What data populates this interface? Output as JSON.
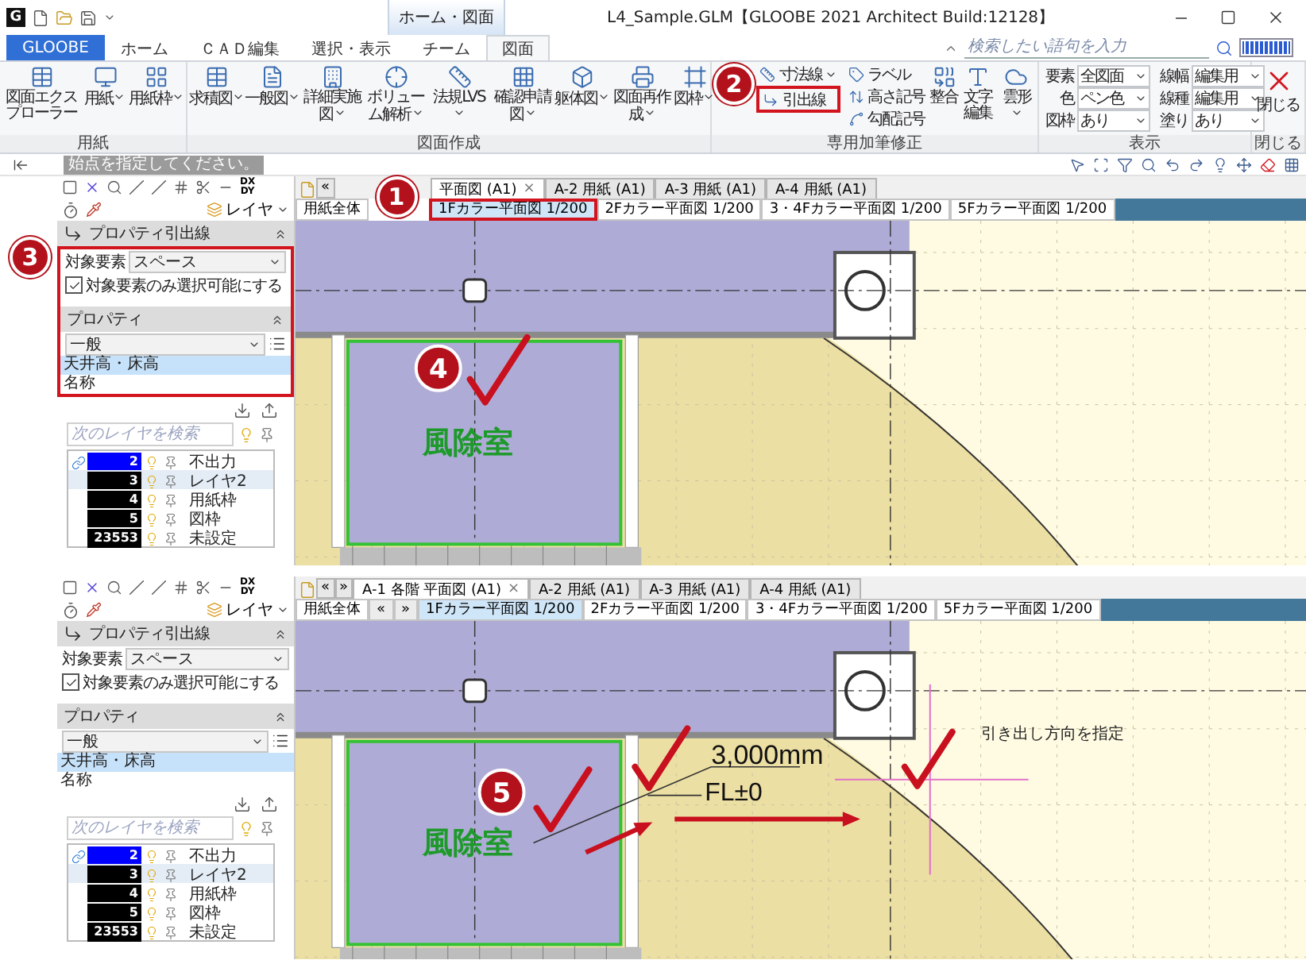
{
  "title_bar": {
    "app_logo": "G",
    "context_tab": "ホーム・図面",
    "title": "L4_Sample.GLM【GLOOBE 2021 Architect Build:12128】"
  },
  "ribbon_tabs": [
    {
      "label": "GLOOBE",
      "kind": "app",
      "selected": false
    },
    {
      "label": "ホーム",
      "kind": "tab",
      "selected": false
    },
    {
      "label": "ＣＡＤ編集",
      "kind": "tab",
      "selected": false
    },
    {
      "label": "選択・表示",
      "kind": "tab",
      "selected": false
    },
    {
      "label": "チーム",
      "kind": "tab",
      "selected": false
    },
    {
      "label": "図面",
      "kind": "tab",
      "selected": true
    }
  ],
  "search": {
    "placeholder": "検索したい語句を入力"
  },
  "ribbon_groups": [
    {
      "label": "用紙",
      "items": [
        {
          "kind": "large",
          "label": "図面エクスプローラー",
          "dropdown": false
        },
        {
          "kind": "large",
          "label": "用紙",
          "dropdown": true
        },
        {
          "kind": "large",
          "label": "用紙枠",
          "dropdown": true
        }
      ]
    },
    {
      "label": "図面作成",
      "items": [
        {
          "kind": "large",
          "label": "求積図",
          "dropdown": true
        },
        {
          "kind": "large",
          "label": "一般図",
          "dropdown": true
        },
        {
          "kind": "large",
          "label": "詳細実施図",
          "dropdown": true
        },
        {
          "kind": "large",
          "label": "ボリューム解析",
          "dropdown": true
        },
        {
          "kind": "large",
          "label": "法規LVS",
          "dropdown": true
        },
        {
          "kind": "large",
          "label": "確認申請図",
          "dropdown": true
        },
        {
          "kind": "large",
          "label": "躯体図",
          "dropdown": true
        },
        {
          "kind": "large",
          "label": "図面再作成",
          "dropdown": true
        },
        {
          "kind": "large",
          "label": "図枠",
          "dropdown": true
        }
      ]
    },
    {
      "label": "専用加筆修正",
      "badge": "2",
      "items": [
        {
          "kind": "stack",
          "buttons": [
            {
              "label": "寸法線",
              "dropdown": true,
              "highlighted": false
            },
            {
              "label": "引出線",
              "dropdown": false,
              "highlighted": true
            }
          ]
        },
        {
          "kind": "stack",
          "buttons": [
            {
              "label": "ラベル",
              "dropdown": false,
              "highlighted": false
            },
            {
              "label": "高さ記号",
              "dropdown": false,
              "highlighted": false
            },
            {
              "label": "勾配記号",
              "dropdown": false,
              "highlighted": false
            }
          ]
        },
        {
          "kind": "large",
          "label": "整合",
          "dropdown": false
        },
        {
          "kind": "large",
          "label": "文字編集",
          "dropdown": false
        },
        {
          "kind": "large",
          "label": "雲形",
          "dropdown": true
        }
      ]
    },
    {
      "label": "表示",
      "items": [
        {
          "kind": "settings",
          "fields": [
            {
              "label": "要素",
              "value": "全図面"
            },
            {
              "label": "色",
              "value": "ペン色"
            },
            {
              "label": "図枠",
              "value": "あり"
            },
            {
              "label": "線幅",
              "value": "編集用"
            },
            {
              "label": "線種",
              "value": "編集用"
            },
            {
              "label": "塗り",
              "value": "あり"
            }
          ]
        }
      ]
    },
    {
      "label": "閉じる",
      "items": [
        {
          "kind": "large",
          "label": "閉じる",
          "dropdown": false
        }
      ]
    }
  ],
  "prompt": "始点を指定してください。",
  "views": [
    {
      "panel": {
        "badge": "3",
        "highlighted": true,
        "offset_label": "DX\nDY",
        "layer_button": "レイヤ",
        "leader_title": "プロパティ引出線",
        "target_label": "対象要素",
        "target_value": "スペース",
        "only_target": {
          "label": "対象要素のみ選択可能にする",
          "checked": true
        },
        "property_title": "プロパティ",
        "property_category": "一般",
        "property_items": [
          {
            "label": "天井高・床高",
            "selected": true
          },
          {
            "label": "名称",
            "selected": false
          }
        ],
        "layer_search_placeholder": "次のレイヤを検索",
        "layers": [
          {
            "number": "2",
            "name": "不出力",
            "color": "#0000ff",
            "current": true,
            "selected": false
          },
          {
            "number": "3",
            "name": "レイヤ2",
            "color": "#000000",
            "current": false,
            "selected": true
          },
          {
            "number": "4",
            "name": "用紙枠",
            "color": "#000000",
            "current": false,
            "selected": false
          },
          {
            "number": "5",
            "name": "図枠",
            "color": "#000000",
            "current": false,
            "selected": false
          },
          {
            "number": "23553",
            "name": "未設定",
            "color": "#000000",
            "current": false,
            "selected": false
          }
        ]
      },
      "canvas": {
        "tab_badge": "1",
        "badge": "4",
        "nav": [
          "«"
        ],
        "tabs": [
          {
            "label": "平面図 (A1)",
            "close": "×",
            "selected": true
          },
          {
            "label": "A-2 用紙 (A1)",
            "selected": false
          },
          {
            "label": "A-3 用紙 (A1)",
            "selected": false
          },
          {
            "label": "A-4 用紙 (A1)",
            "selected": false
          }
        ],
        "sheet_tabs": [
          {
            "label": "用紙全体",
            "kind": "sheet",
            "selected": false,
            "highlighted": false
          },
          {
            "label": "1Fカラー平面図 1/200",
            "kind": "sheet",
            "selected": true,
            "highlighted": true
          },
          {
            "label": "2Fカラー平面図 1/200",
            "kind": "sheet",
            "selected": false,
            "highlighted": false
          },
          {
            "label": "3・4Fカラー平面図 1/200",
            "kind": "sheet",
            "selected": false,
            "highlighted": false
          },
          {
            "label": "5Fカラー平面図 1/200",
            "kind": "sheet",
            "selected": false,
            "highlighted": false
          }
        ],
        "room_label": "風除室"
      }
    },
    {
      "panel": {
        "highlighted": false,
        "offset_label": "DX\nDY",
        "layer_button": "レイヤ",
        "leader_title": "プロパティ引出線",
        "target_label": "対象要素",
        "target_value": "スペース",
        "only_target": {
          "label": "対象要素のみ選択可能にする",
          "checked": true
        },
        "property_title": "プロパティ",
        "property_category": "一般",
        "property_items": [
          {
            "label": "天井高・床高",
            "selected": true
          },
          {
            "label": "名称",
            "selected": false
          }
        ],
        "layer_search_placeholder": "次のレイヤを検索",
        "layers": [
          {
            "number": "2",
            "name": "不出力",
            "color": "#0000ff",
            "current": true,
            "selected": false
          },
          {
            "number": "3",
            "name": "レイヤ2",
            "color": "#000000",
            "current": false,
            "selected": true
          },
          {
            "number": "4",
            "name": "用紙枠",
            "color": "#000000",
            "current": false,
            "selected": false
          },
          {
            "number": "5",
            "name": "図枠",
            "color": "#000000",
            "current": false,
            "selected": false
          },
          {
            "number": "23553",
            "name": "未設定",
            "color": "#000000",
            "current": false,
            "selected": false
          }
        ]
      },
      "canvas": {
        "badge": "5",
        "nav": [
          "«",
          "»"
        ],
        "tabs": [
          {
            "label": "A-1 各階 平面図 (A1)",
            "close": "×",
            "selected": true
          },
          {
            "label": "A-2 用紙 (A1)",
            "selected": false
          },
          {
            "label": "A-3 用紙 (A1)",
            "selected": false
          },
          {
            "label": "A-4 用紙 (A1)",
            "selected": false
          }
        ],
        "sheet_tabs": [
          {
            "label": "用紙全体",
            "kind": "sheet",
            "selected": false,
            "highlighted": false
          },
          {
            "label": "«",
            "kind": "nav",
            "selected": false,
            "highlighted": false
          },
          {
            "label": "»",
            "kind": "nav",
            "selected": false,
            "highlighted": false
          },
          {
            "label": "1Fカラー平面図 1/200",
            "kind": "sheet",
            "selected": true,
            "highlighted": false
          },
          {
            "label": "2Fカラー平面図 1/200",
            "kind": "sheet",
            "selected": false,
            "highlighted": false
          },
          {
            "label": "3・4Fカラー平面図 1/200",
            "kind": "sheet",
            "selected": false,
            "highlighted": false
          },
          {
            "label": "5Fカラー平面図 1/200",
            "kind": "sheet",
            "selected": false,
            "highlighted": false
          }
        ],
        "room_label": "風除室",
        "leader": {
          "height_text": "3,000mm",
          "level_text": "FL±0",
          "hint": "引き出し方向を指定"
        }
      }
    }
  ]
}
